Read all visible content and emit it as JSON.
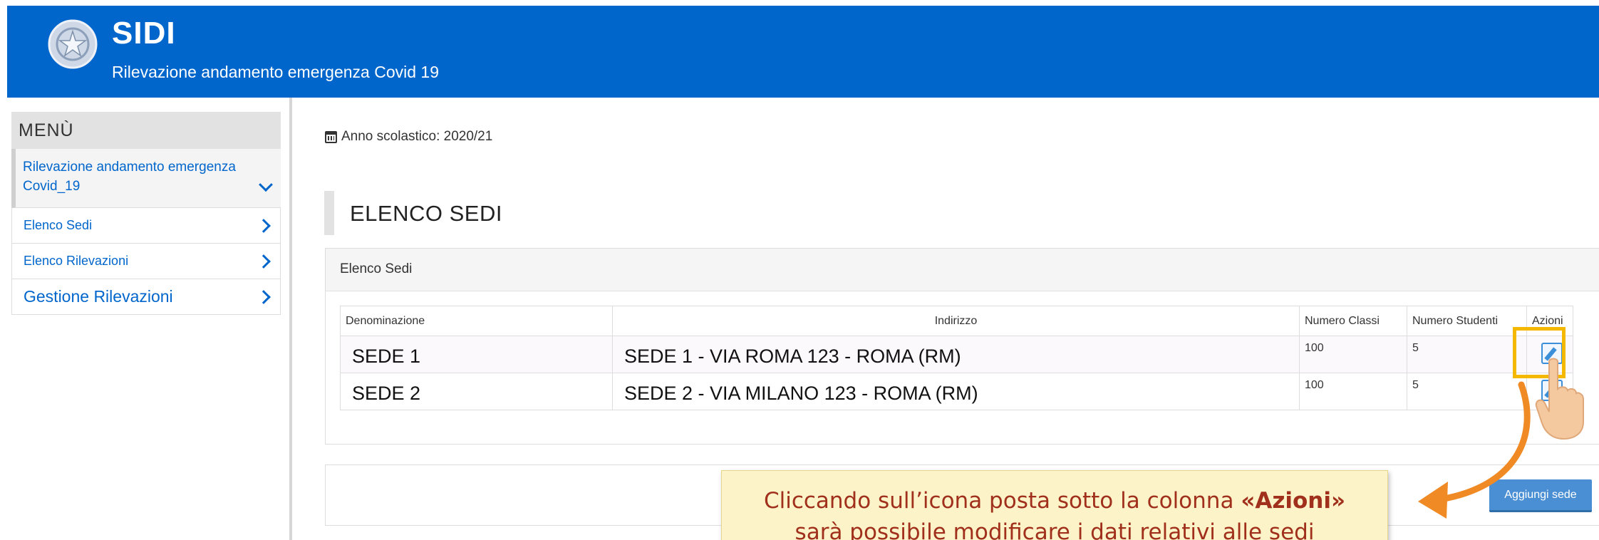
{
  "header": {
    "title": "SIDI",
    "subtitle": "Rilevazione andamento emergenza Covid 19",
    "band_color": "#0066cc"
  },
  "sidebar": {
    "title": "MENÙ",
    "active_line1": "Rilevazione andamento emergenza",
    "active_line2": "Covid_19",
    "items": [
      {
        "label": "Elenco Sedi"
      },
      {
        "label": "Elenco Rilevazioni"
      },
      {
        "label": "Gestione Rilevazioni"
      }
    ]
  },
  "main": {
    "school_year": "Anno scolastico: 2020/21",
    "section_title": "ELENCO SEDI",
    "panel_title": "Elenco Sedi",
    "table": {
      "headers": [
        "Denominazione",
        "Indirizzo",
        "Numero Classi",
        "Numero Studenti",
        "Azioni"
      ],
      "rows": [
        {
          "name": "SEDE 1",
          "address": "SEDE 1 - VIA ROMA 123 - ROMA (RM)",
          "classes": "100",
          "students": "5"
        },
        {
          "name": "SEDE 2",
          "address": "SEDE 2 - VIA MILANO 123 - ROMA (RM)",
          "classes": "100",
          "students": "5"
        }
      ]
    },
    "add_button": "Aggiungi sede"
  },
  "callout": {
    "line1_prefix": "Cliccando sull’icona posta sotto la colonna ",
    "line1_bold": "«Azioni»",
    "line2": "sarà possibile modificare i dati relativi alle sedi"
  },
  "colors": {
    "accent": "#0066cc",
    "highlight": "#f5b800",
    "callout_bg": "#fdf3c8",
    "callout_text": "#a0301c",
    "arrow": "#f08a24"
  },
  "icons": [
    "emblem-icon",
    "calendar-icon",
    "chevron-down-icon",
    "chevron-right-icon",
    "edit-icon",
    "pointing-hand-icon",
    "curved-arrow-icon"
  ]
}
